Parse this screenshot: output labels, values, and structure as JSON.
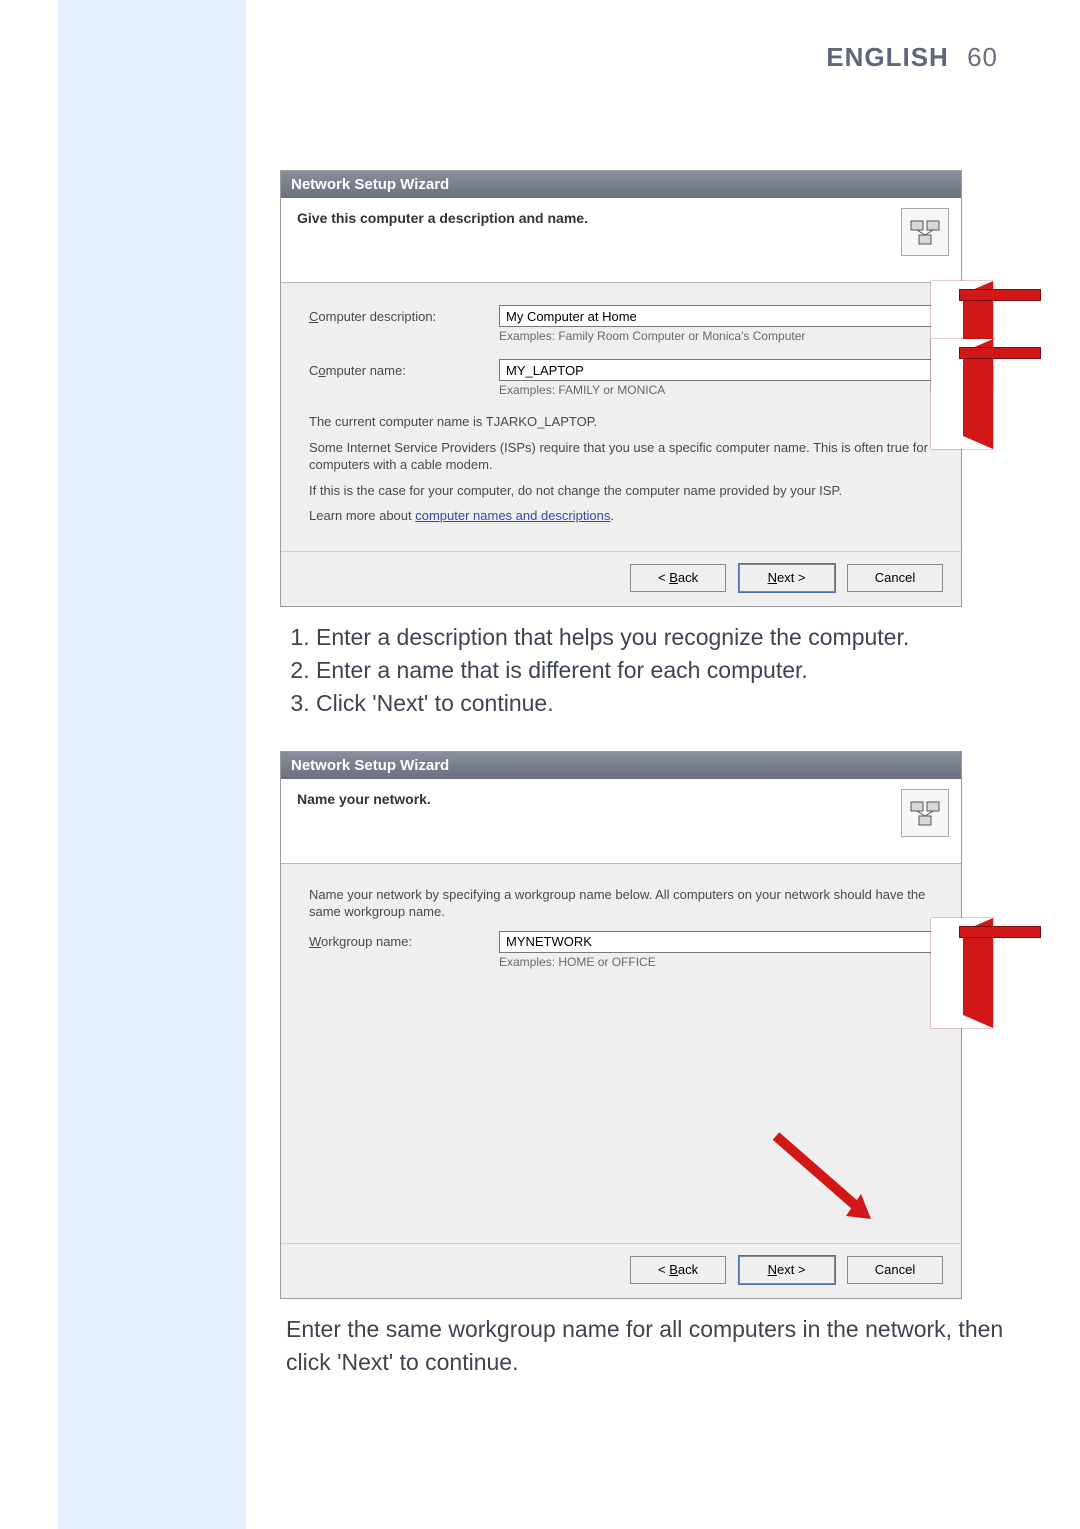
{
  "header": {
    "language": "ENGLISH",
    "page_number": "60"
  },
  "wizard1": {
    "title": "Network Setup Wizard",
    "heading": "Give this computer a description and name.",
    "icon": "network-setup-icon",
    "desc_label": "Computer description:",
    "desc_value": "My Computer at Home",
    "desc_hint": "Examples: Family Room Computer or Monica's Computer",
    "name_label": "Computer name:",
    "name_value": "MY_LAPTOP",
    "name_hint": "Examples: FAMILY or MONICA",
    "current_name_line": "The current computer name is TJARKO_LAPTOP.",
    "isp_note": "Some Internet Service Providers (ISPs) require that you use a specific computer name. This is often true for computers with a cable modem.",
    "isp_note2": "If this is the case for your computer, do not change the computer name provided by your ISP.",
    "learn_more_prefix": "Learn more about ",
    "learn_more_link": "computer names and descriptions",
    "learn_more_suffix": ".",
    "btn_back": "< Back",
    "btn_next": "Next >",
    "btn_cancel": "Cancel"
  },
  "steps": {
    "s1": "Enter a description that helps you recognize the computer.",
    "s2": "Enter a name that is different for each computer.",
    "s3": "Click 'Next' to continue."
  },
  "wizard2": {
    "title": "Network Setup Wizard",
    "heading": "Name your network.",
    "intro": "Name your network by specifying a workgroup name below. All computers on your network should have the same workgroup name.",
    "wg_label": "Workgroup name:",
    "wg_value": "MYNETWORK",
    "wg_hint": "Examples: HOME or OFFICE",
    "btn_back": "< Back",
    "btn_next": "Next >",
    "btn_cancel": "Cancel"
  },
  "footer_note": "Enter the same workgroup name for all computers in the network, then click 'Next' to continue."
}
